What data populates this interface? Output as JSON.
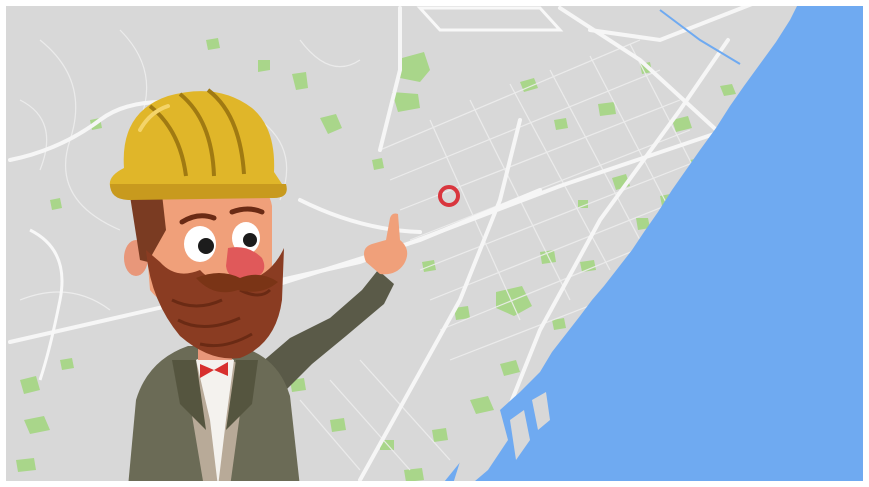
{
  "scene": {
    "colors": {
      "land": "#d8d8d8",
      "road": "#f4f4f4",
      "park": "#a9d68a",
      "sea": "#6faaf1",
      "marker": "#d9363e",
      "frame": "#ffffff"
    },
    "icons": {
      "location_marker": "location-ring-icon",
      "character": "construction-worker-illustration"
    }
  }
}
